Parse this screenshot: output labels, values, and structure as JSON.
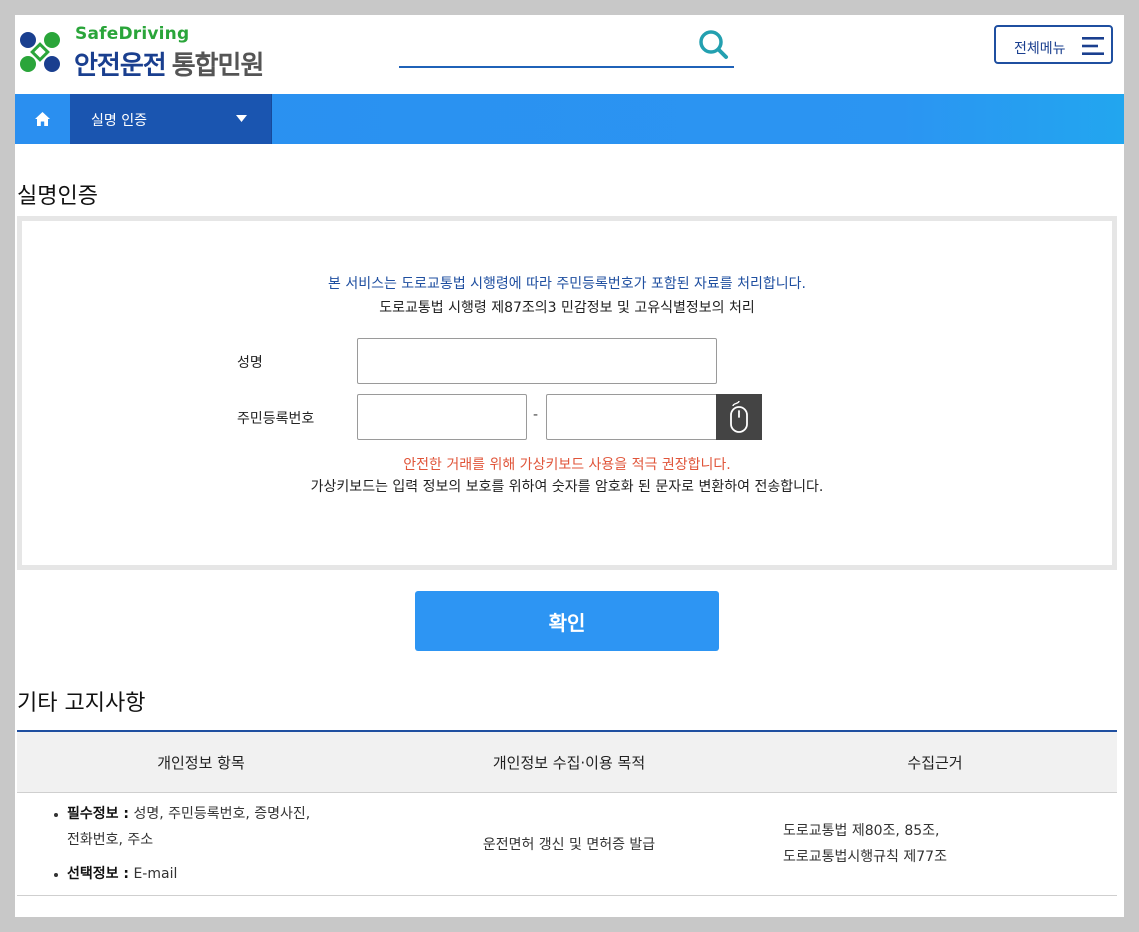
{
  "header": {
    "logo_sub": "SafeDriving",
    "logo_main": "안전운전",
    "logo_main_gray": "통합민원",
    "search_placeholder": "",
    "menu_label": "전체메뉴"
  },
  "nav": {
    "current": "실명 인증"
  },
  "verify": {
    "title": "실명인증",
    "notice_1": "본 서비스는 도로교통법 시행령에 따라 주민등록번호가 포함된 자료를 처리합니다.",
    "notice_2": "도로교통법 시행령 제87조의3 민감정보 및 고유식별정보의 처리",
    "name_label": "성명",
    "rrn_label": "주민등록번호",
    "rrn_separator": "-",
    "name_value": "",
    "rrn_front_value": "",
    "rrn_back_value": "",
    "warn_1": "안전한 거래를 위해 가상키보드 사용을 적극 권장합니다.",
    "warn_2": "가상키보드는 입력 정보의 보호를 위하여 숫자를 암호화 된 문자로 변환하여 전송합니다."
  },
  "confirm_label": "확인",
  "notice_section": {
    "title": "기타 고지사항",
    "headers": [
      "개인정보 항목",
      "개인정보 수집·이용 목적",
      "수집근거"
    ],
    "required_label": "필수정보 :",
    "required_text": " 성명, 주민등록번호, 증명사진,",
    "required_text_2": "전화번호, 주소",
    "optional_label": "선택정보 :",
    "optional_text": " E-mail",
    "purpose": "운전면허 갱신 및 면허증 발급",
    "basis_1": "도로교통법 제80조, 85조,",
    "basis_2": "도로교통법시행규칙 제77조"
  },
  "colors": {
    "brand_blue": "#1a3f8f",
    "brand_green": "#2aa53a",
    "nav_blue": "#2a8ff0",
    "nav_selected": "#1a55b0",
    "confirm_blue": "#2d95f3",
    "warning_red": "#e0553a"
  },
  "icons": {
    "logo": "safedriving-cross-logo-icon",
    "search": "search-icon",
    "menu": "hamburger-icon",
    "home": "home-icon",
    "dropdown": "caret-down-icon",
    "virtual_keyboard": "mouse-icon"
  }
}
